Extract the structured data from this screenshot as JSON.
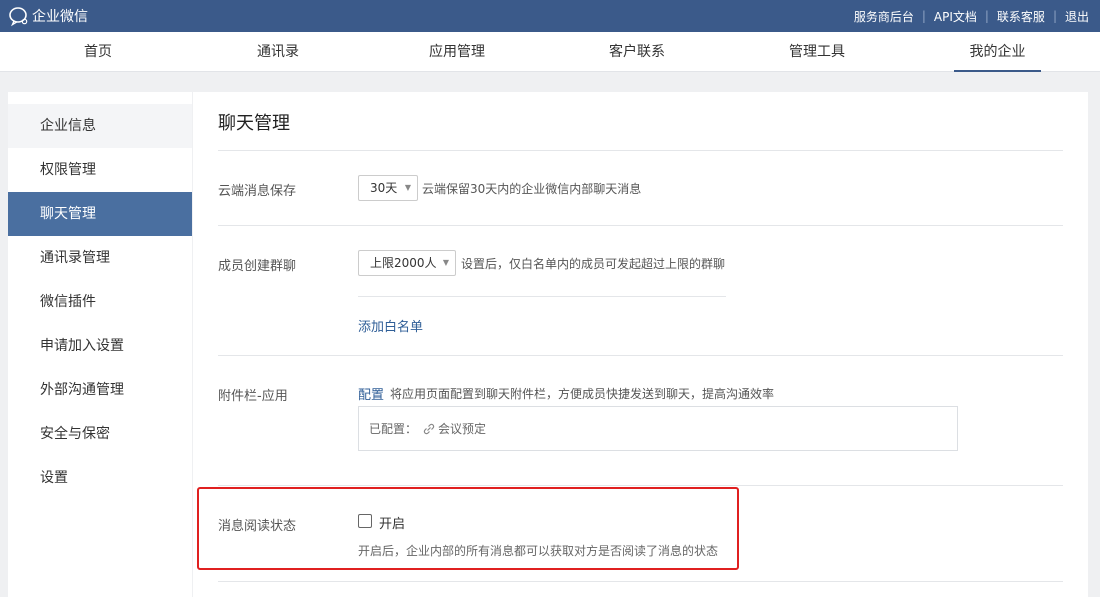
{
  "topbar": {
    "app_name": "企业微信",
    "links": [
      "服务商后台",
      "API文档",
      "联系客服",
      "退出"
    ],
    "bg_color": "#3b5a8a"
  },
  "nav": {
    "items": [
      "首页",
      "通讯录",
      "应用管理",
      "客户联系",
      "管理工具",
      "我的企业"
    ],
    "active": "我的企业"
  },
  "sidebar": {
    "items": [
      "企业信息",
      "权限管理",
      "聊天管理",
      "通讯录管理",
      "微信插件",
      "申请加入设置",
      "外部沟通管理",
      "安全与保密",
      "设置"
    ],
    "active": "聊天管理"
  },
  "main": {
    "title": "聊天管理",
    "cloud_storage": {
      "label": "云端消息保存",
      "select_value": "30天",
      "hint": "云端保留30天内的企业微信内部聊天消息"
    },
    "group_chat": {
      "label": "成员创建群聊",
      "select_value": "上限2000人",
      "hint": "设置后，仅白名单内的成员可发起超过上限的群聊",
      "whitelist_link": "添加白名单"
    },
    "attachment_bar": {
      "label": "附件栏-应用",
      "config_link": "配置",
      "hint": "将应用页面配置到聊天附件栏，方便成员快捷发送到聊天，提高沟通效率",
      "configured_label": "已配置：",
      "configured_app": "会议预定",
      "configured_app_icon": "link-icon"
    },
    "read_status": {
      "label": "消息阅读状态",
      "checkbox_label": "开启",
      "checked": false,
      "desc": "开启后，企业内部的所有消息都可以获取对方是否阅读了消息的状态"
    }
  },
  "annotation": {
    "highlight_color": "#e02020"
  }
}
